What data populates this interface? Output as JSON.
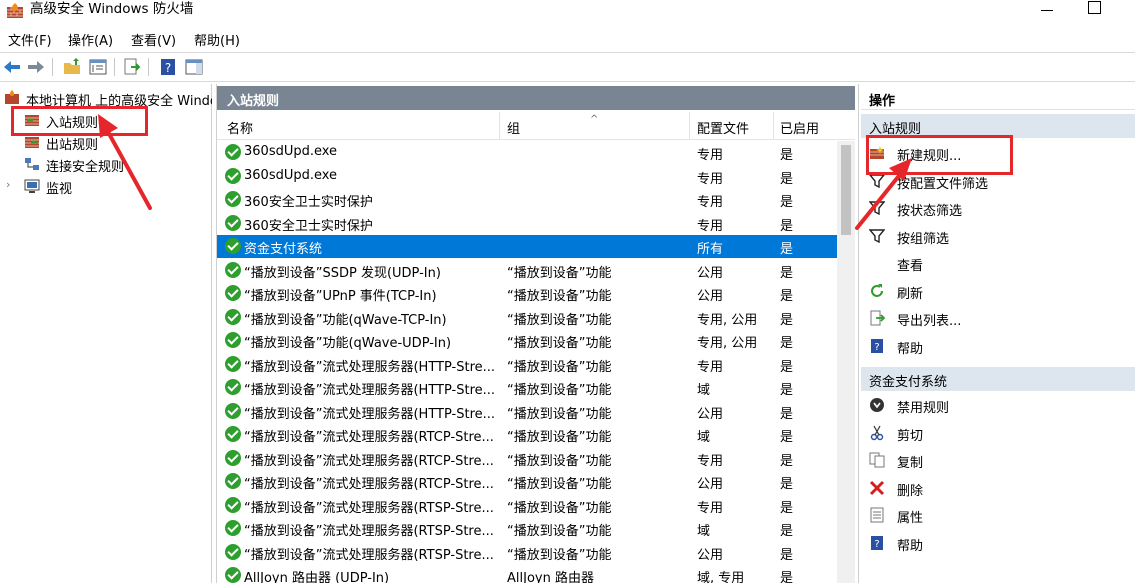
{
  "window": {
    "title": "高级安全 Windows 防火墙"
  },
  "menubar": [
    "文件(F)",
    "操作(A)",
    "查看(V)",
    "帮助(H)"
  ],
  "tree": {
    "root": "本地计算机 上的高级安全 Windows",
    "items": [
      "入站规则",
      "出站规则",
      "连接安全规则",
      "监视"
    ]
  },
  "middle": {
    "header": "入站规则",
    "columns": {
      "name": "名称",
      "group": "组",
      "profile": "配置文件",
      "enabled": "已启用"
    },
    "rows": [
      {
        "name": "360sdUpd.exe",
        "group": "",
        "profile": "专用",
        "enabled": "是"
      },
      {
        "name": "360sdUpd.exe",
        "group": "",
        "profile": "专用",
        "enabled": "是"
      },
      {
        "name": "360安全卫士实时保护",
        "group": "",
        "profile": "专用",
        "enabled": "是"
      },
      {
        "name": "360安全卫士实时保护",
        "group": "",
        "profile": "专用",
        "enabled": "是"
      },
      {
        "name": "资金支付系统",
        "group": "",
        "profile": "所有",
        "enabled": "是",
        "selected": true
      },
      {
        "name": "“播放到设备”SSDP 发现(UDP-In)",
        "group": "“播放到设备”功能",
        "profile": "公用",
        "enabled": "是"
      },
      {
        "name": "“播放到设备”UPnP 事件(TCP-In)",
        "group": "“播放到设备”功能",
        "profile": "公用",
        "enabled": "是"
      },
      {
        "name": "“播放到设备”功能(qWave-TCP-In)",
        "group": "“播放到设备”功能",
        "profile": "专用, 公用",
        "enabled": "是"
      },
      {
        "name": "“播放到设备”功能(qWave-UDP-In)",
        "group": "“播放到设备”功能",
        "profile": "专用, 公用",
        "enabled": "是"
      },
      {
        "name": "“播放到设备”流式处理服务器(HTTP-Stre...",
        "group": "“播放到设备”功能",
        "profile": "专用",
        "enabled": "是"
      },
      {
        "name": "“播放到设备”流式处理服务器(HTTP-Stre...",
        "group": "“播放到设备”功能",
        "profile": "域",
        "enabled": "是"
      },
      {
        "name": "“播放到设备”流式处理服务器(HTTP-Stre...",
        "group": "“播放到设备”功能",
        "profile": "公用",
        "enabled": "是"
      },
      {
        "name": "“播放到设备”流式处理服务器(RTCP-Stre...",
        "group": "“播放到设备”功能",
        "profile": "域",
        "enabled": "是"
      },
      {
        "name": "“播放到设备”流式处理服务器(RTCP-Stre...",
        "group": "“播放到设备”功能",
        "profile": "专用",
        "enabled": "是"
      },
      {
        "name": "“播放到设备”流式处理服务器(RTCP-Stre...",
        "group": "“播放到设备”功能",
        "profile": "公用",
        "enabled": "是"
      },
      {
        "name": "“播放到设备”流式处理服务器(RTSP-Stre...",
        "group": "“播放到设备”功能",
        "profile": "专用",
        "enabled": "是"
      },
      {
        "name": "“播放到设备”流式处理服务器(RTSP-Stre...",
        "group": "“播放到设备”功能",
        "profile": "域",
        "enabled": "是"
      },
      {
        "name": "“播放到设备”流式处理服务器(RTSP-Stre...",
        "group": "“播放到设备”功能",
        "profile": "公用",
        "enabled": "是"
      },
      {
        "name": "AllJoyn 路由器 (UDP-In)",
        "group": "AllJoyn 路由器",
        "profile": "域, 专用",
        "enabled": "是"
      }
    ]
  },
  "actions": {
    "title": "操作",
    "section1": {
      "header": "入站规则",
      "items": [
        {
          "label": "新建规则...",
          "icon": "new-rule-icon"
        },
        {
          "label": "按配置文件筛选",
          "icon": "filter-icon"
        },
        {
          "label": "按状态筛选",
          "icon": "filter-icon"
        },
        {
          "label": "按组筛选",
          "icon": "filter-icon"
        },
        {
          "label": "查看",
          "icon": ""
        },
        {
          "label": "刷新",
          "icon": "refresh-icon"
        },
        {
          "label": "导出列表...",
          "icon": "export-icon"
        },
        {
          "label": "帮助",
          "icon": "help-icon"
        }
      ]
    },
    "section2": {
      "header": "资金支付系统",
      "items": [
        {
          "label": "禁用规则",
          "icon": "disable-icon"
        },
        {
          "label": "剪切",
          "icon": "cut-icon"
        },
        {
          "label": "复制",
          "icon": "copy-icon"
        },
        {
          "label": "删除",
          "icon": "delete-icon"
        },
        {
          "label": "属性",
          "icon": "properties-icon"
        },
        {
          "label": "帮助",
          "icon": "help-icon"
        }
      ]
    }
  },
  "colors": {
    "selected": "#0078d7",
    "header": "#7a8593",
    "annotation": "#e5262a",
    "section": "#dde5ef"
  }
}
